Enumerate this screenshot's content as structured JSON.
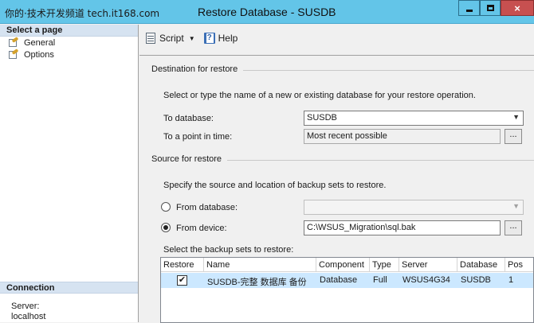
{
  "watermark": "你的·技术开发频道 tech.it168.com",
  "window": {
    "title": "Restore Database - SUSDB",
    "close_glyph": "×"
  },
  "left_panel": {
    "select_header": "Select a page",
    "pages": [
      {
        "label": "General"
      },
      {
        "label": "Options"
      }
    ],
    "connection_header": "Connection",
    "server_label": "Server:",
    "server_value": "localhost"
  },
  "toolbar": {
    "script_label": "Script",
    "help_label": "Help"
  },
  "destination": {
    "section_title": "Destination for restore",
    "description": "Select or type the name of a new or existing database for your restore operation.",
    "to_database_label": "To database:",
    "to_database_value": "SUSDB",
    "point_in_time_label": "To a point in time:",
    "point_in_time_value": "Most recent possible",
    "ellipsis": "..."
  },
  "source": {
    "section_title": "Source for restore",
    "description": "Specify the source and location of backup sets to restore.",
    "from_database_label": "From database:",
    "from_database_value": "",
    "from_device_label": "From device:",
    "from_device_value": "C:\\WSUS_Migration\\sql.bak",
    "selected_option": "From device",
    "backup_sets_label": "Select the backup sets to restore:",
    "columns": [
      "Restore",
      "Name",
      "Component",
      "Type",
      "Server",
      "Database",
      "Pos"
    ],
    "rows": [
      {
        "restore": true,
        "restore_mark": "✔",
        "name": "SUSDB-完整 数据库 备份",
        "component": "Database",
        "type": "Full",
        "server": "WSUS4G34",
        "database": "SUSDB",
        "position": "1"
      }
    ]
  },
  "colors": {
    "titlebar": "#63c5e8",
    "close": "#c75050",
    "panel_header": "#d6e3f1",
    "row_selected": "#cce8ff"
  }
}
